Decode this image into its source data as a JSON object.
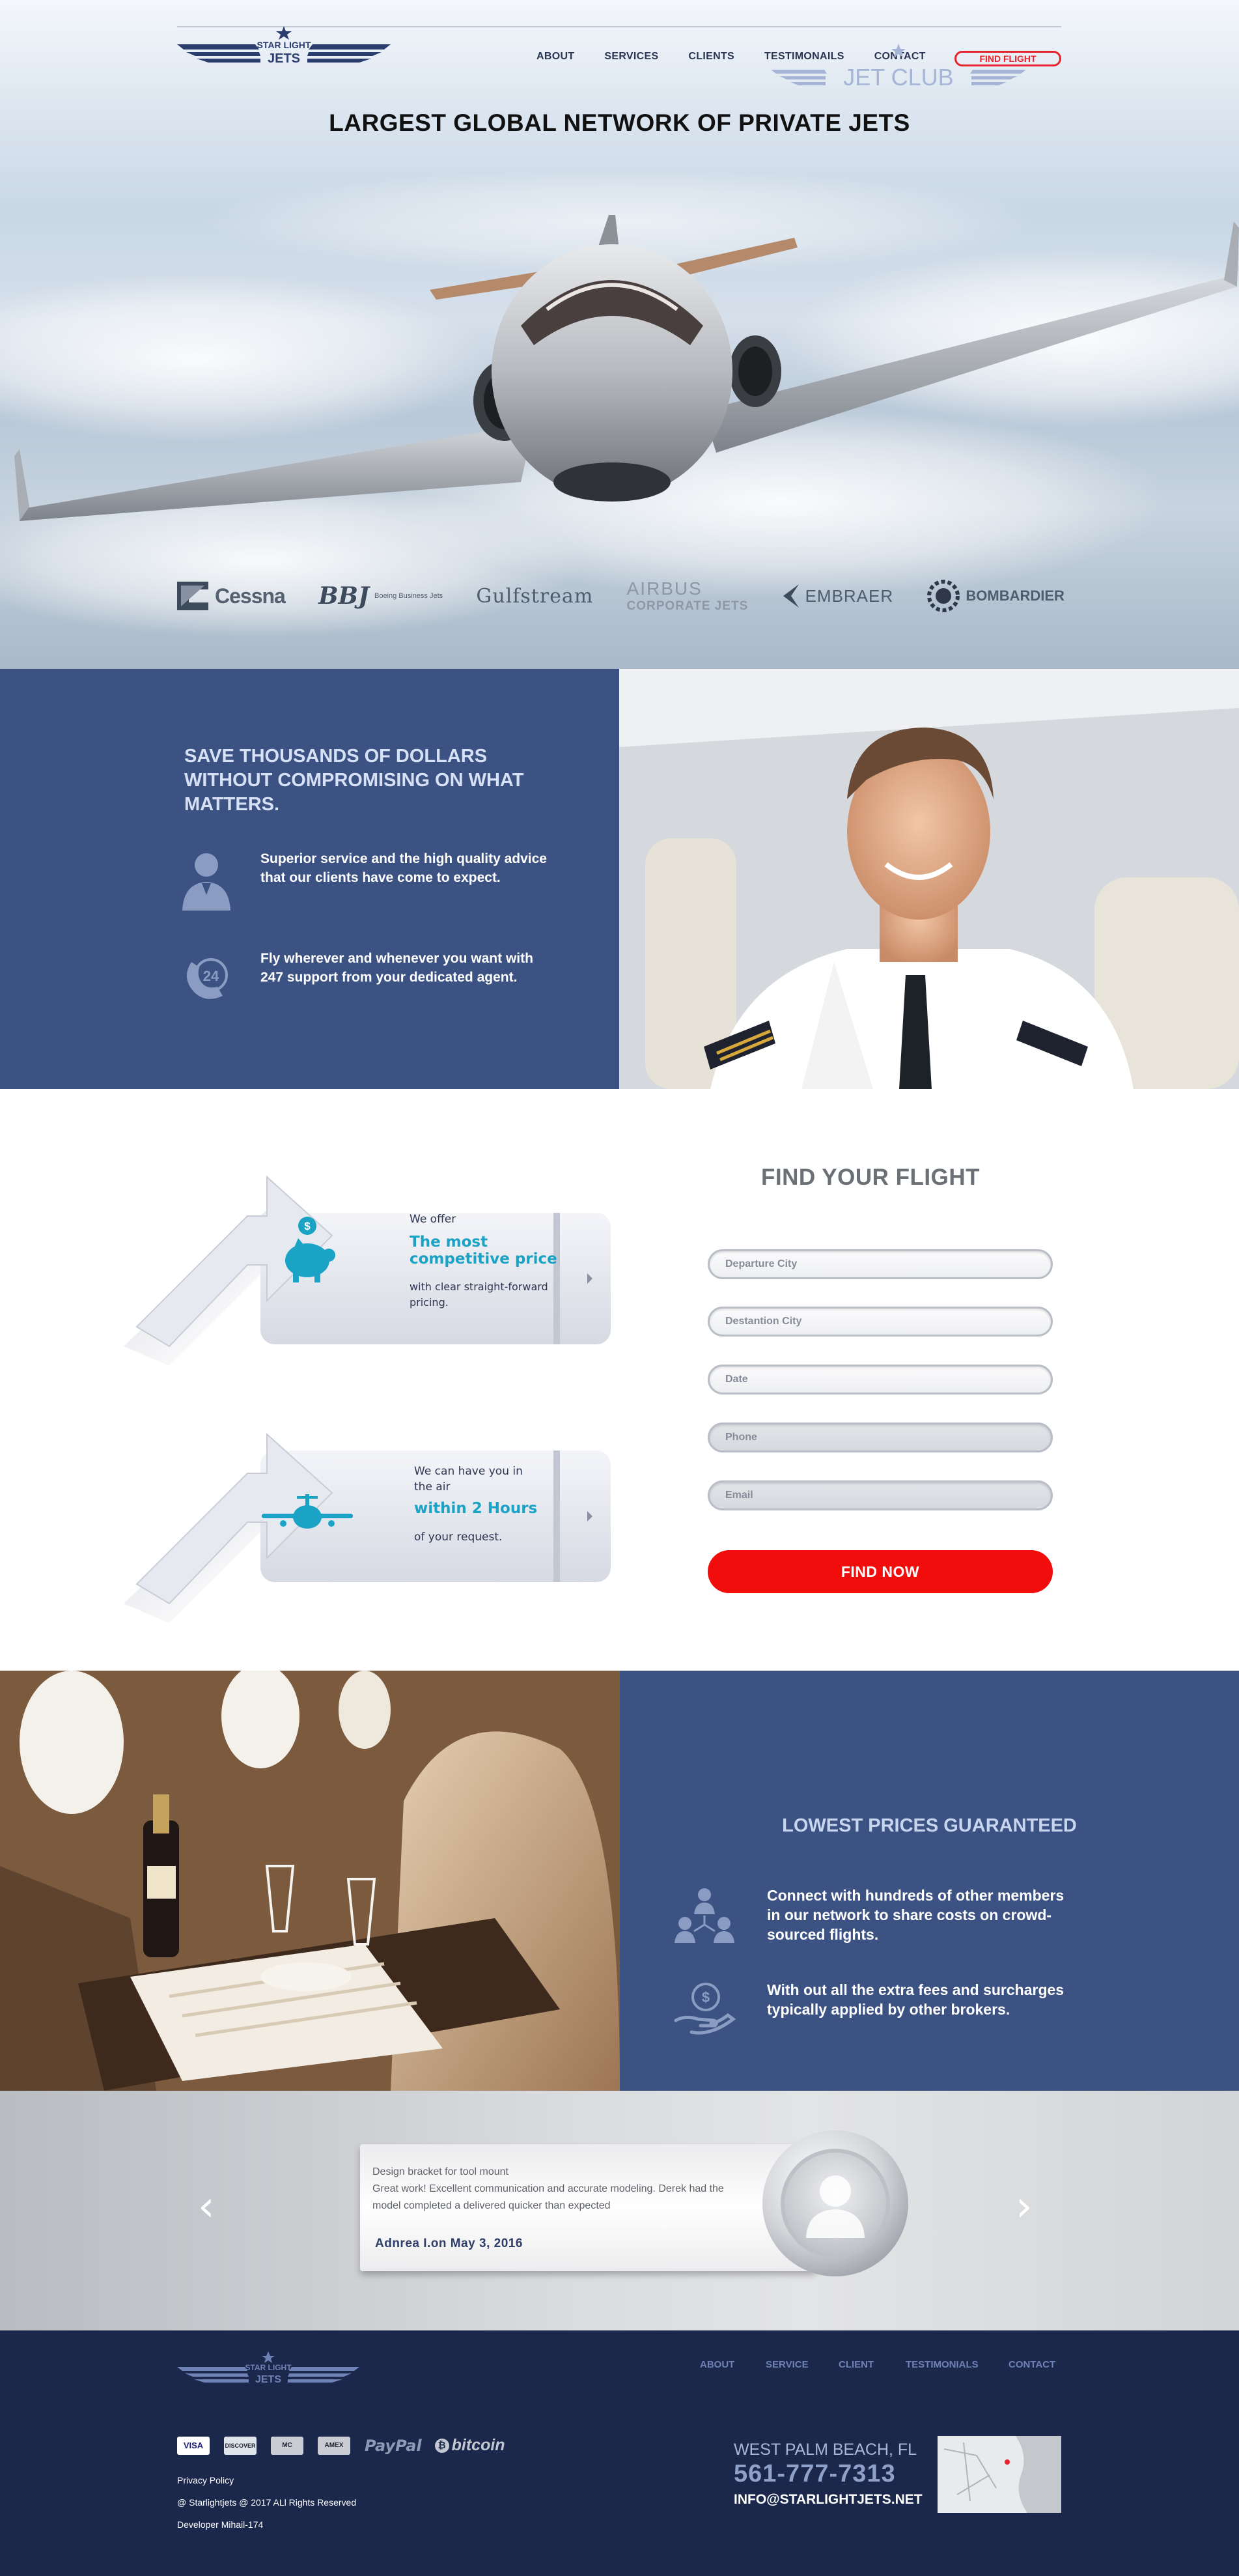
{
  "brand": {
    "top": "STAR LIGHT",
    "bottom": "JETS",
    "accent_color": "#3b5282",
    "red": "#e8222a"
  },
  "nav": {
    "items": [
      "ABOUT",
      "SERVICES",
      "CLIENTS",
      "TESTIMONAILS",
      "CONTACT"
    ],
    "find_flight_label": "FIND FLIGHT"
  },
  "hero": {
    "title": "LARGEST GLOBAL NETWORK OF PRIVATE JETS",
    "brands": [
      {
        "name": "Cessna",
        "icon": "cessna-logo-icon"
      },
      {
        "name": "Boeing Business Jets",
        "icon": "bbj-logo-icon"
      },
      {
        "name": "Gulfstream",
        "icon": ""
      },
      {
        "name": "AIRBUS",
        "sub": "CORPORATE JETS",
        "icon": ""
      },
      {
        "name": "EMBRAER",
        "icon": "embraer-logo-icon"
      },
      {
        "name": "BOMBARDIER",
        "icon": "bombardier-logo-icon"
      }
    ]
  },
  "save": {
    "heading": "SAVE THOUSANDS OF DOLLARS WITHOUT COMPROMISING ON WHAT MATTERS.",
    "features": [
      {
        "icon": "agent-icon",
        "text": "Superior service and the high quality advice that our clients have come to expect."
      },
      {
        "icon": "support-24-icon",
        "text": "Fly wherever and whenever you want with 247 support from your dedicated agent."
      }
    ]
  },
  "offers": [
    {
      "icon": "piggy-bank-icon",
      "line1": "We offer",
      "highlight": "The most competitive price",
      "line2": "with clear straight-forward pricing."
    },
    {
      "icon": "airplane-icon",
      "line1": "We can have you in the air",
      "highlight": "within  2 Hours",
      "line2": "of your request."
    }
  ],
  "find_flight": {
    "title": "FIND YOUR FLIGHT",
    "fields": [
      "Departure City",
      "Destantion City",
      "Date",
      "Phone",
      "Email"
    ],
    "button": "FIND NOW"
  },
  "club": {
    "logo_text": "JET CLUB",
    "subtitle": "LOWEST PRICES GUARANTEED",
    "features": [
      {
        "icon": "network-icon",
        "text": "Connect with hundreds of other members in our network to share costs on crowd-sourced flights."
      },
      {
        "icon": "dollar-hand-icon",
        "text": "With out all the extra fees and surcharges typically applied by other brokers."
      }
    ]
  },
  "testimonial": {
    "title": "Design bracket for tool mount",
    "body": "Great work! Excellent communication and accurate modeling. Derek had the model completed a delivered quicker than expected",
    "author": "Adnrea I.on May 3, 2016",
    "prev": "‹",
    "next": "›"
  },
  "footer": {
    "nav": [
      "ABOUT",
      "SERVICE",
      "CLIENT",
      "TESTIMONIALS",
      "CONTACT"
    ],
    "payments": [
      "VISA",
      "DISCOVER",
      "MC",
      "AMEX",
      "PayPal",
      "bitcoin"
    ],
    "privacy": "Privacy Policy",
    "copyright": "@ Starlightjets @ 2017 ALl Rights Reserved",
    "developer": "Developer Mihail-174",
    "city": "WEST PALM BEACH, FL",
    "phone": "561-777-7313",
    "email": "INFO@STARLIGHTJETS.NET"
  }
}
